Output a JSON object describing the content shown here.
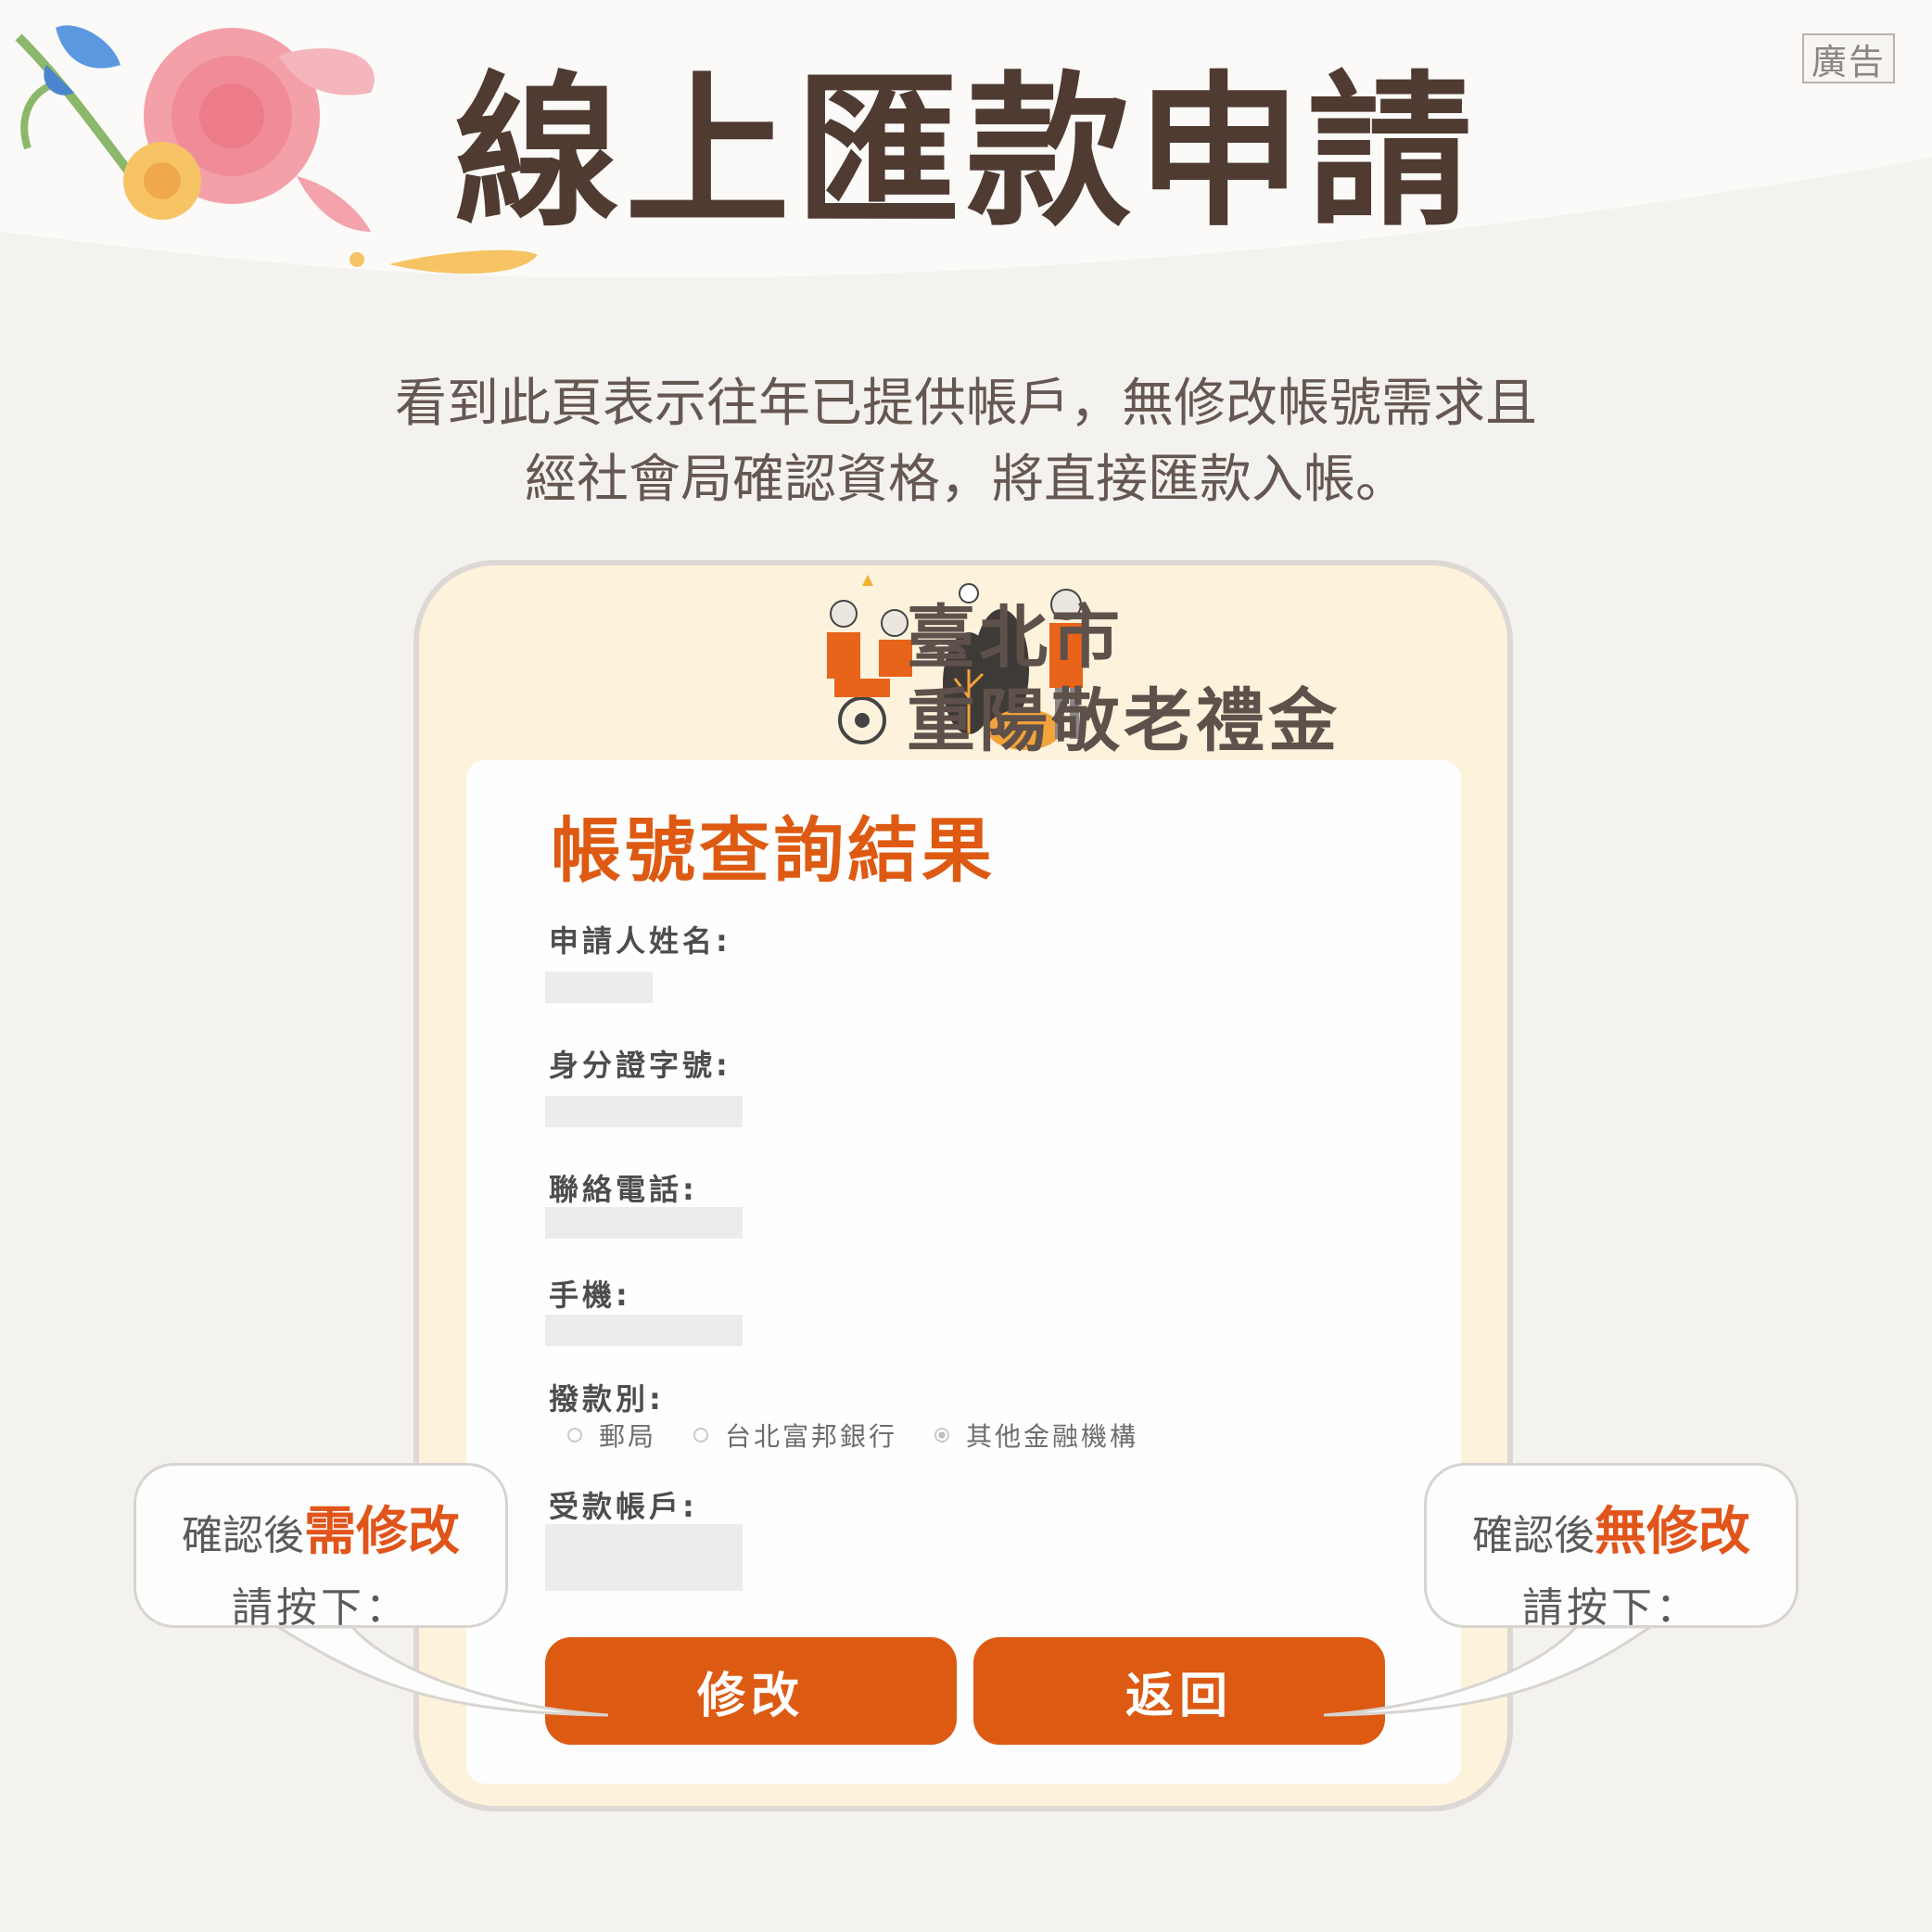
{
  "ad_badge": "廣告",
  "title": "線上匯款申請",
  "intro": {
    "line1": "看到此頁表示往年已提供帳戶，無修改帳號需求且",
    "line2": "經社會局確認資格，將直接匯款入帳。"
  },
  "banner": {
    "city": "臺北市",
    "title": "重陽敬老禮金"
  },
  "form": {
    "heading": "帳號查詢結果",
    "fields": {
      "name_label": "申請人姓名:",
      "id_label": "身分證字號:",
      "phone_label": "聯絡電話:",
      "mobile_label": "手機:",
      "payment_label": "撥款別:",
      "account_label": "受款帳戶:"
    },
    "payment_options": [
      "郵局",
      "台北富邦銀行",
      "其他金融機構"
    ],
    "payment_selected": "其他金融機構"
  },
  "buttons": {
    "modify": "修改",
    "back": "返回"
  },
  "callouts": {
    "left": {
      "prefix": "確認後",
      "emphasis": "需修改",
      "line2": "請按下："
    },
    "right": {
      "prefix": "確認後",
      "emphasis": "無修改",
      "line2": "請按下："
    }
  },
  "colors": {
    "accent_orange": "#dd5a13",
    "title_brown": "#4f3b31",
    "card_cream": "#fdf2dc",
    "background": "#f4f2ef"
  }
}
